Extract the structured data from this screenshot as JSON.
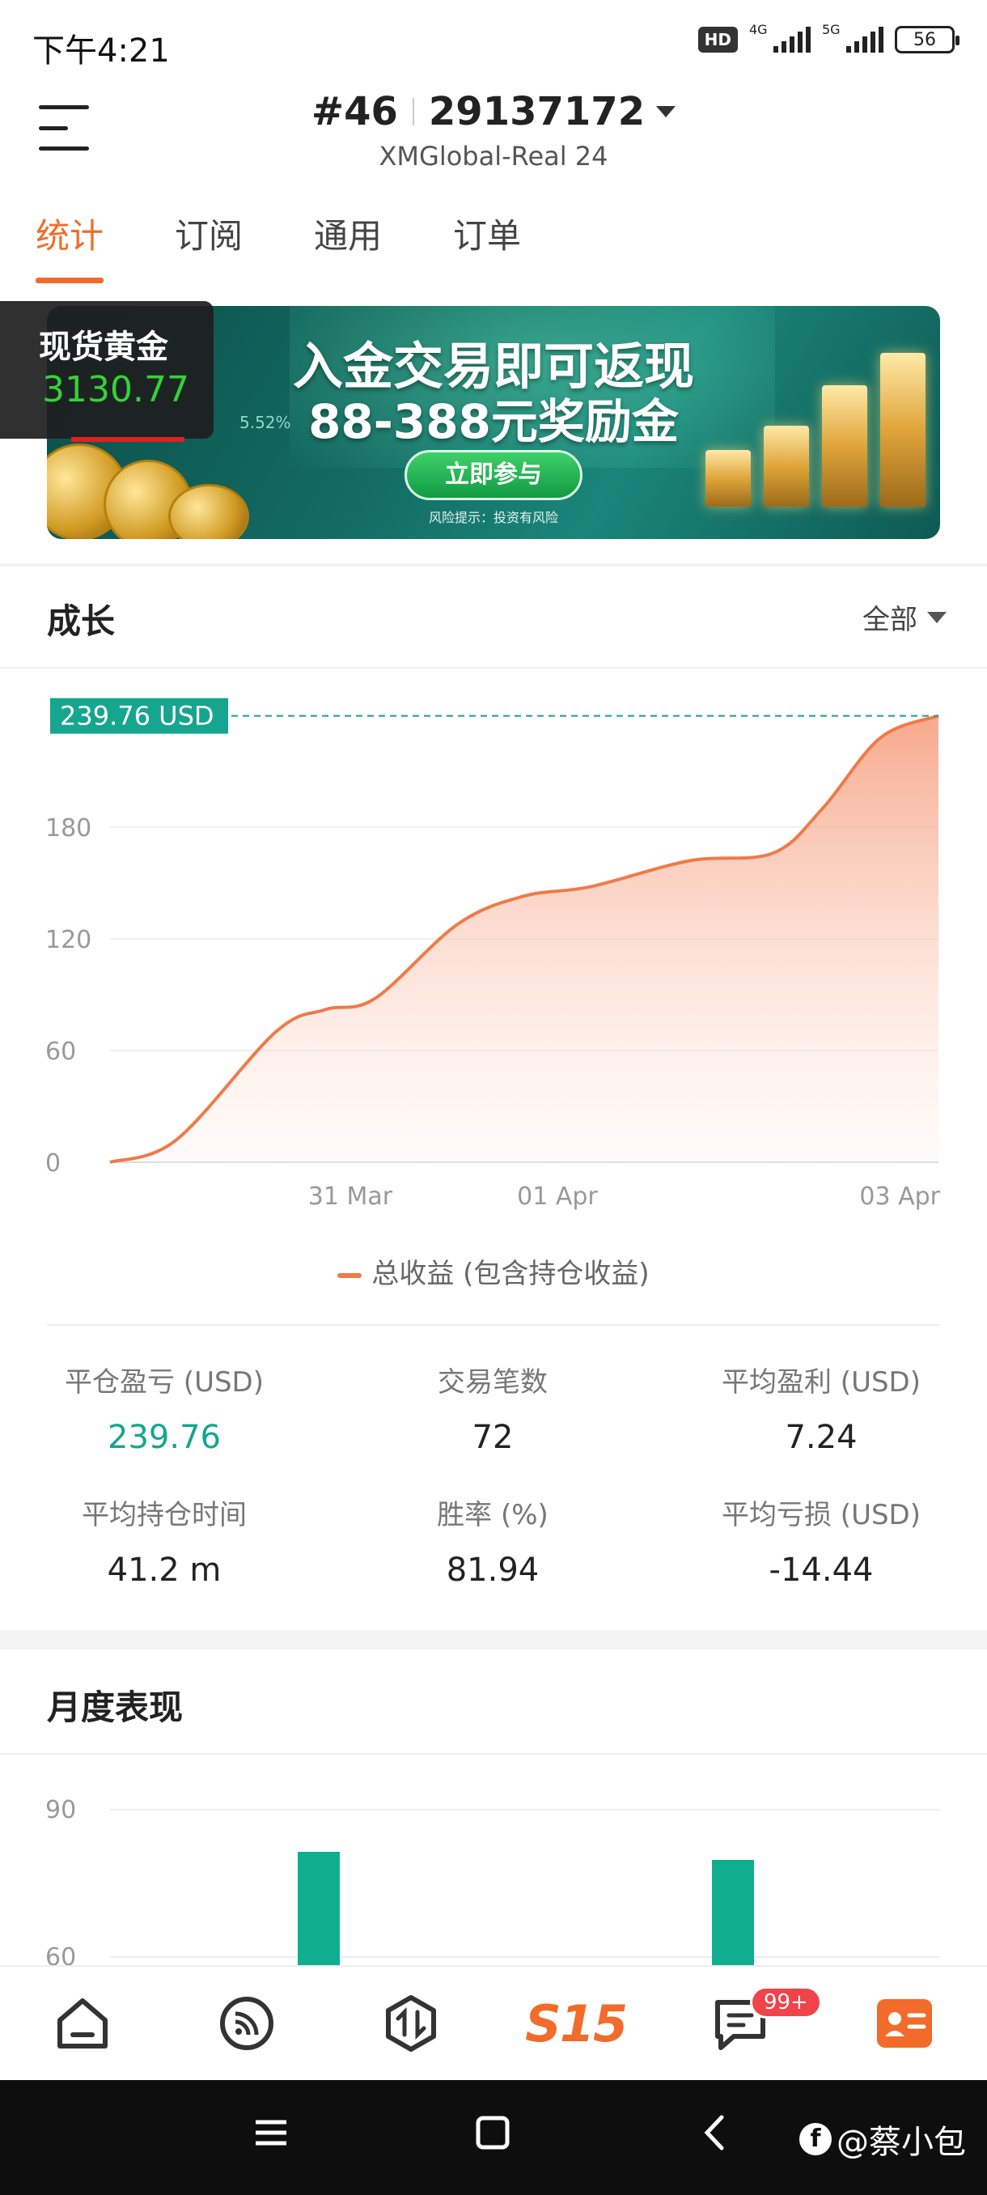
{
  "status_bar": {
    "time": "下午4:21",
    "hd": "HD",
    "net1": "4G",
    "net2": "5G",
    "battery": "56"
  },
  "header": {
    "account_number": "#46",
    "account_id": "29137172",
    "server": "XMGlobal-Real 24"
  },
  "tabs": [
    {
      "label": "统计",
      "active": true
    },
    {
      "label": "订阅",
      "active": false
    },
    {
      "label": "通用",
      "active": false
    },
    {
      "label": "订单",
      "active": false
    }
  ],
  "banner": {
    "line1": "入金交易即可返现",
    "line2": "88-388元奖励金",
    "button": "立即参与",
    "risk": "风险提示：投资有风险",
    "pct": "5.52%"
  },
  "ticker": {
    "name": "现货黄金",
    "price": "3130.77",
    "price_color": "#35d13b"
  },
  "growth": {
    "title": "成长",
    "filter": "全部",
    "current_label": "239.76 USD",
    "legend": "总收益 (包含持仓收益)",
    "accent_color": "#f07a4a"
  },
  "chart_data": {
    "type": "area",
    "title": "",
    "xlabel": "",
    "ylabel": "",
    "x_ticks": [
      "31 Mar",
      "01 Apr",
      "03 Apr"
    ],
    "y_ticks": [
      0,
      60,
      120,
      180
    ],
    "ylim": [
      0,
      240
    ],
    "series": [
      {
        "name": "总收益 (包含持仓收益)",
        "x": [
          0,
          0.08,
          0.2,
          0.26,
          0.32,
          0.42,
          0.5,
          0.58,
          0.7,
          0.8,
          0.86,
          0.93,
          1.0
        ],
        "values": [
          0,
          12,
          70,
          82,
          88,
          128,
          143,
          148,
          162,
          166,
          190,
          228,
          239.76
        ]
      }
    ],
    "reference_line": 239.76
  },
  "stats": [
    {
      "label": "平仓盈亏 (USD)",
      "value": "239.76",
      "green": true
    },
    {
      "label": "交易笔数",
      "value": "72",
      "green": false
    },
    {
      "label": "平均盈利 (USD)",
      "value": "7.24",
      "green": false
    },
    {
      "label": "平均持仓时间",
      "value": "41.2 m",
      "green": false
    },
    {
      "label": "胜率 (%)",
      "value": "81.94",
      "green": false
    },
    {
      "label": "平均亏损 (USD)",
      "value": "-14.44",
      "green": false
    }
  ],
  "monthly": {
    "title": "月度表现",
    "y_ticks": [
      90,
      60
    ],
    "bar_color": "#0fae8f"
  },
  "bottom_nav": {
    "items": [
      "home-icon",
      "feed-icon",
      "trade-icon",
      "s15-logo",
      "message-icon",
      "profile-icon"
    ],
    "s15_label": "S15",
    "message_badge": "99+",
    "profile_color": "#f26b2a"
  },
  "watermark": {
    "logo": "f",
    "text": "@蔡小包"
  }
}
